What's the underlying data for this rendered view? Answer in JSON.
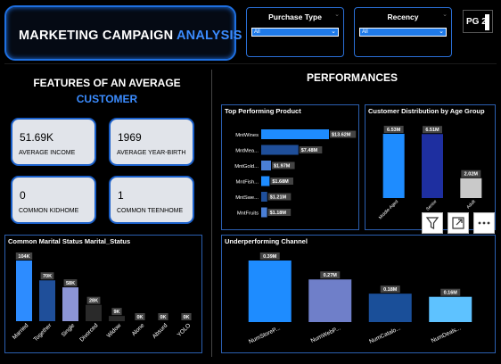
{
  "header": {
    "title_main": "MARKETING CAMPAIGN",
    "title_accent": "ANALYSIS"
  },
  "slicers": [
    {
      "label": "Purchase Type",
      "value": "All"
    },
    {
      "label": "Recency",
      "value": "All"
    }
  ],
  "page_indicator": "PG 2",
  "left_section": {
    "title_line1": "FEATURES OF AN AVERAGE",
    "title_line2": "CUSTOMER"
  },
  "kpis": [
    {
      "value": "51.69K",
      "label": "AVERAGE INCOME"
    },
    {
      "value": "1969",
      "label": "AVERAGE YEAR-BIRTH"
    },
    {
      "value": "0",
      "label": "COMMON KIDHOME"
    },
    {
      "value": "1",
      "label": "COMMON TEENHOME"
    }
  ],
  "right_section": {
    "title": "PERFORMANCES"
  },
  "colors": {
    "accent": "#3b8cff",
    "border": "#1e6fe0",
    "kpi_bg": "#e1e4ea"
  },
  "icons": [
    "filter-icon",
    "focus-mode-icon",
    "more-options-icon"
  ],
  "chart_data": [
    {
      "id": "marital",
      "type": "bar",
      "title": "Common Marital Status Marital_Status",
      "categories": [
        "Married",
        "Together",
        "Single",
        "Divorced",
        "Widow",
        "Alone",
        "Absurd",
        "YOLO"
      ],
      "values": [
        104,
        70,
        58,
        28,
        9,
        0,
        0,
        0
      ],
      "data_labels": [
        "104K",
        "70K",
        "58K",
        "28K",
        "9K",
        "0K",
        "0K",
        "0K"
      ],
      "colors": [
        "#2d8cff",
        "#1f4f9a",
        "#8c95d6",
        "#2a2a2a",
        "#2a2a2a",
        "#2a2a2a",
        "#2a2a2a",
        "#2a2a2a"
      ],
      "ylim": [
        0,
        104
      ]
    },
    {
      "id": "products",
      "type": "bar",
      "orientation": "horizontal",
      "title": "Top Performing Product",
      "categories": [
        "MntWines",
        "MntMea...",
        "MntGold...",
        "MntFish...",
        "MntSwe...",
        "MntFruits"
      ],
      "values": [
        13.62,
        7.48,
        1.97,
        1.68,
        1.21,
        1.18
      ],
      "data_labels": [
        "$13.62M",
        "$7.48M",
        "$1.97M",
        "$1.68M",
        "$1.21M",
        "$1.18M"
      ],
      "colors": [
        "#1e8cff",
        "#1f4f9a",
        "#4a7fd6",
        "#1e8cff",
        "#1f4f9a",
        "#4a7fd6"
      ],
      "xlim": [
        0,
        13.62
      ]
    },
    {
      "id": "age",
      "type": "bar",
      "title": "Customer Distribution by Age Group",
      "categories": [
        "Middle-Aged",
        "Senior",
        "Adult"
      ],
      "values": [
        6.53,
        6.51,
        2.02
      ],
      "data_labels": [
        "6.53M",
        "6.51M",
        "2.02M"
      ],
      "colors": [
        "#1e8cff",
        "#1e2fa0",
        "#c9c9c9"
      ],
      "ylim": [
        0,
        6.53
      ]
    },
    {
      "id": "channel",
      "type": "bar",
      "title": "Underperforming Channel",
      "categories": [
        "NumStoreP...",
        "NumWebP...",
        "NumCatalo...",
        "NumDeals..."
      ],
      "values": [
        0.39,
        0.27,
        0.18,
        0.16
      ],
      "data_labels": [
        "0.39M",
        "0.27M",
        "0.18M",
        "0.16M"
      ],
      "colors": [
        "#1e8cff",
        "#6f7fc9",
        "#1a4f99",
        "#5ec2ff"
      ],
      "ylim": [
        0,
        0.39
      ]
    }
  ]
}
